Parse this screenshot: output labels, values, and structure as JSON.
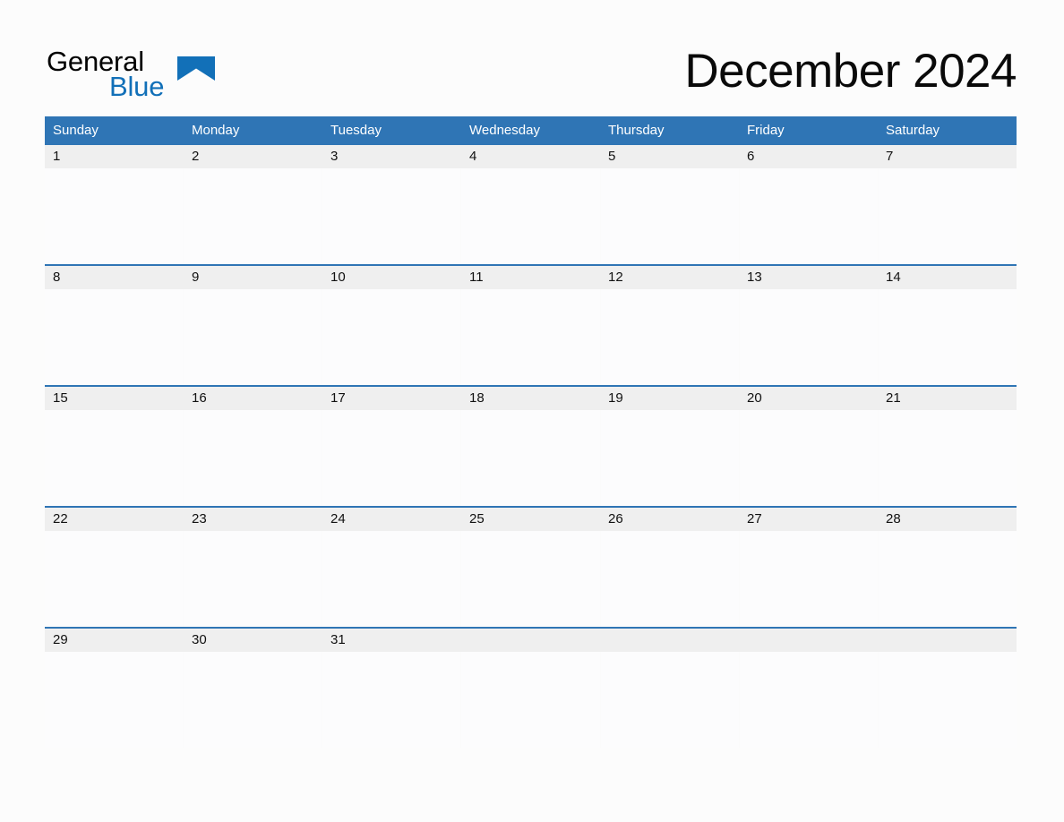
{
  "brand": {
    "name_part_1": "General",
    "name_part_2": "Blue",
    "triangle_icon": "blue-triangle-icon",
    "black": "#010101",
    "blue": "#1270b8"
  },
  "header": {
    "title": "December 2024",
    "month": "December",
    "year": "2024"
  },
  "colors": {
    "header_blue": "#2f75b5",
    "separator_blue": "#2f75b5",
    "date_band_gray": "#efefef",
    "page_background": "#fcfcfc",
    "cell_background": "#fcfcfd",
    "date_text": "#111111",
    "weekday_text": "#ffffff"
  },
  "calendar": {
    "weekdays": [
      "Sunday",
      "Monday",
      "Tuesday",
      "Wednesday",
      "Thursday",
      "Friday",
      "Saturday"
    ],
    "weeks": [
      {
        "days": [
          {
            "date": "1",
            "notes": ""
          },
          {
            "date": "2",
            "notes": ""
          },
          {
            "date": "3",
            "notes": ""
          },
          {
            "date": "4",
            "notes": ""
          },
          {
            "date": "5",
            "notes": ""
          },
          {
            "date": "6",
            "notes": ""
          },
          {
            "date": "7",
            "notes": ""
          }
        ]
      },
      {
        "days": [
          {
            "date": "8",
            "notes": ""
          },
          {
            "date": "9",
            "notes": ""
          },
          {
            "date": "10",
            "notes": ""
          },
          {
            "date": "11",
            "notes": ""
          },
          {
            "date": "12",
            "notes": ""
          },
          {
            "date": "13",
            "notes": ""
          },
          {
            "date": "14",
            "notes": ""
          }
        ]
      },
      {
        "days": [
          {
            "date": "15",
            "notes": ""
          },
          {
            "date": "16",
            "notes": ""
          },
          {
            "date": "17",
            "notes": ""
          },
          {
            "date": "18",
            "notes": ""
          },
          {
            "date": "19",
            "notes": ""
          },
          {
            "date": "20",
            "notes": ""
          },
          {
            "date": "21",
            "notes": ""
          }
        ]
      },
      {
        "days": [
          {
            "date": "22",
            "notes": ""
          },
          {
            "date": "23",
            "notes": ""
          },
          {
            "date": "24",
            "notes": ""
          },
          {
            "date": "25",
            "notes": ""
          },
          {
            "date": "26",
            "notes": ""
          },
          {
            "date": "27",
            "notes": ""
          },
          {
            "date": "28",
            "notes": ""
          }
        ]
      },
      {
        "days": [
          {
            "date": "29",
            "notes": ""
          },
          {
            "date": "30",
            "notes": ""
          },
          {
            "date": "31",
            "notes": ""
          },
          {
            "date": "",
            "notes": ""
          },
          {
            "date": "",
            "notes": ""
          },
          {
            "date": "",
            "notes": ""
          },
          {
            "date": "",
            "notes": ""
          }
        ]
      }
    ]
  }
}
